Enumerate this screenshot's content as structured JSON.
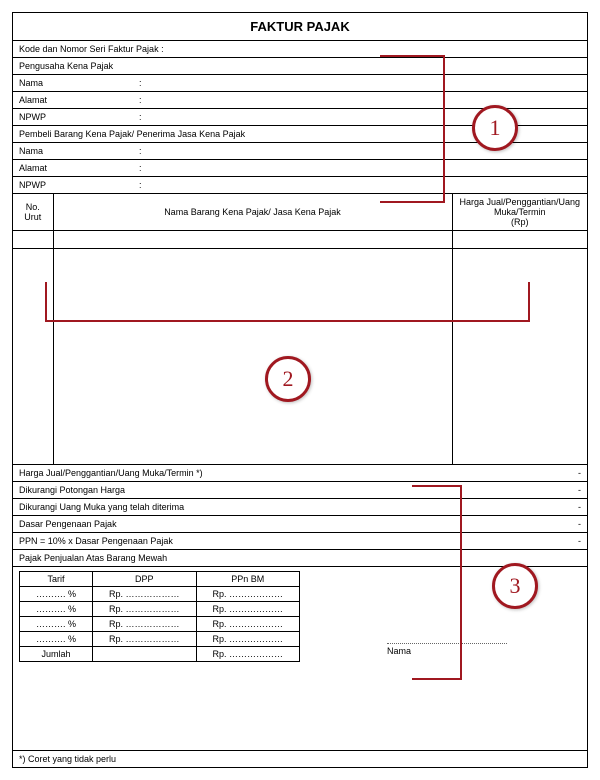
{
  "title": "FAKTUR PAJAK",
  "line_kode": "Kode dan Nomor Seri Faktur Pajak :",
  "seller": {
    "header": "Pengusaha Kena Pajak",
    "nama": "Nama",
    "alamat": "Alamat",
    "npwp": "NPWP"
  },
  "buyer": {
    "header": "Pembeli Barang Kena Pajak/ Penerima Jasa Kena Pajak",
    "nama": "Nama",
    "alamat": "Alamat",
    "npwp": "NPWP"
  },
  "colon": ":",
  "cols": {
    "no": "No.\nUrut",
    "desc": "Nama Barang Kena Pajak/ Jasa Kena Pajak",
    "price": "Harga Jual/Penggantian/Uang\nMuka/Termin\n(Rp)"
  },
  "totals": {
    "r1": "Harga Jual/Penggantian/Uang Muka/Termin *)",
    "r2": "Dikurangi Potongan Harga",
    "r3": "Dikurangi Uang Muka yang telah diterima",
    "r4": "Dasar Pengenaan Pajak",
    "r5": "PPN = 10% x Dasar Pengenaan Pajak",
    "dash": "-"
  },
  "lux": {
    "header": "Pajak Penjualan Atas Barang Mewah",
    "tarif": "Tarif",
    "dpp": "DPP",
    "ppnbm": "PPn BM",
    "pct": "………. %",
    "rp": "Rp. ………………",
    "jumlah": "Jumlah"
  },
  "sig": "Nama",
  "foot": "*) Coret yang tidak perlu",
  "callouts": {
    "a": "1",
    "b": "2",
    "c": "3"
  }
}
